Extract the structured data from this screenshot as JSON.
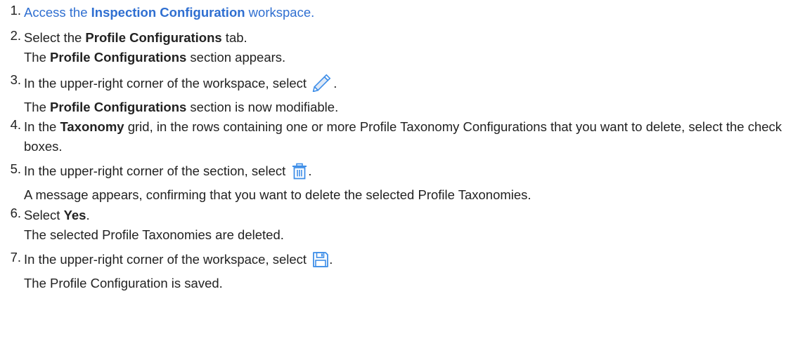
{
  "steps": [
    {
      "n": "1.",
      "pre": "Access the ",
      "bold": "Inspection Configuration",
      "post": " workspace."
    },
    {
      "n": "2.",
      "pre": "Select the ",
      "bold": "Profile Configurations",
      "post": " tab.",
      "r_pre": "The ",
      "r_bold": "Profile Configurations",
      "r_post": " section appears."
    },
    {
      "n": "3.",
      "pre": "In the upper-right corner of the workspace, select ",
      "post": ".",
      "icon": "pencil-icon",
      "r_pre": "The ",
      "r_bold": "Profile Configurations",
      "r_post": " section is now modifiable."
    },
    {
      "n": "4.",
      "pre": "In the ",
      "bold": "Taxonomy",
      "post": " grid, in the rows containing one or more Profile Taxonomy Configurations that you want to delete, select the check boxes."
    },
    {
      "n": "5.",
      "pre": "In the upper-right corner of the section, select ",
      "post": ".",
      "icon": "trash-icon",
      "result": "A message appears, confirming that you want to delete the selected Profile Taxonomies."
    },
    {
      "n": "6.",
      "pre": "Select ",
      "bold": "Yes",
      "post": ".",
      "result": "The selected Profile Taxonomies are deleted."
    },
    {
      "n": "7.",
      "pre": "In the upper-right corner of the workspace, select ",
      "post": ".",
      "icon": "save-icon",
      "result": "The Profile Configuration is saved."
    }
  ],
  "colors": {
    "link": "#2f6fd1",
    "icon": "#3e8ee8",
    "text": "#222222"
  }
}
